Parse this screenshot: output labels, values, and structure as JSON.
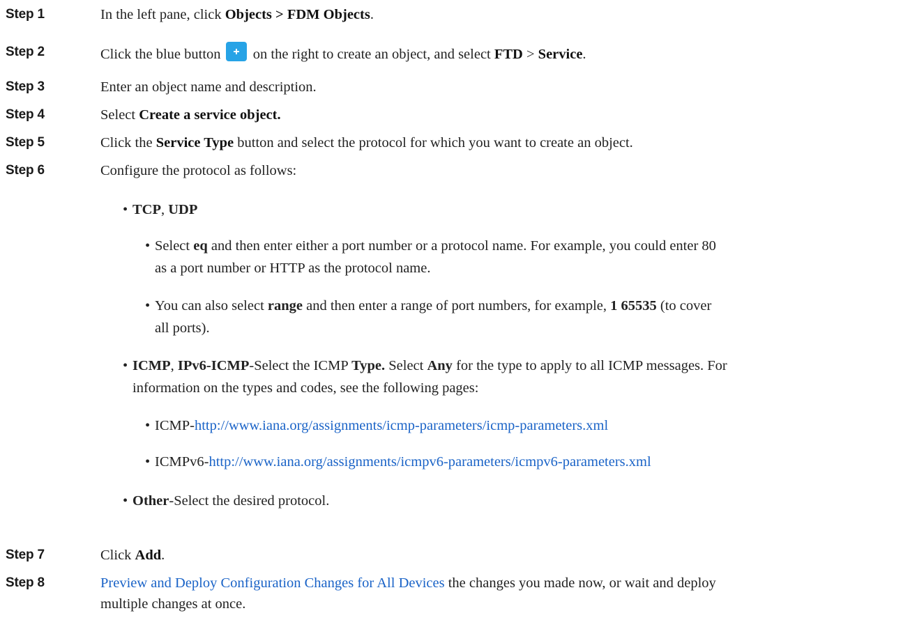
{
  "steps": [
    {
      "label": "Step 1",
      "pre": "In the left pane, click ",
      "bold": "Objects > FDM Objects",
      "post": "."
    },
    {
      "label": "Step 2",
      "pre": "Click the blue button",
      "mid": " on the right to create an object, and select ",
      "b1": "FTD",
      "sep": " > ",
      "b2": "Service",
      "post": "."
    },
    {
      "label": "Step 3",
      "text": "Enter an object name and description."
    },
    {
      "label": "Step 4",
      "pre": "Select ",
      "bold": "Create a service object."
    },
    {
      "label": "Step 5",
      "pre": "Click the ",
      "bold": "Service Type",
      "post": " button and select the protocol for which you want to create an object."
    },
    {
      "label": "Step 6",
      "text": "Configure the protocol as follows:"
    },
    {
      "label": "Step 7",
      "pre": "Click ",
      "bold": "Add",
      "post": "."
    },
    {
      "label": "Step 8",
      "link": "Preview and Deploy Configuration Changes for All Devices",
      "post1": " the changes you made now, or wait and deploy",
      "post2": "multiple changes at once."
    }
  ],
  "tcp": {
    "b1": "TCP",
    "sep": ", ",
    "b2": "UDP"
  },
  "eq": {
    "pre": "Select ",
    "bold": "eq",
    "line1": " and then enter either a port number or a protocol name. For example, you could enter 80",
    "line2": "as a port number or HTTP as the protocol name."
  },
  "range": {
    "pre": "You can also select ",
    "bold": "range",
    "mid": " and then enter a range of port numbers, for example, ",
    "bold2": "1 65535",
    "line1end": " (to cover",
    "line2": "all ports)."
  },
  "icmp": {
    "b1": "ICMP",
    "sep": ", ",
    "b2": "IPv6-ICMP",
    "mid": "-Select the ICMP ",
    "b3": "Type.",
    "mid2": " Select ",
    "b4": "Any",
    "line1end": " for the type to apply to all ICMP messages. For",
    "line2": "information on the types and codes, see the following pages:"
  },
  "icmp_links": [
    {
      "prefix": "ICMP-",
      "url": "http://www.iana.org/assignments/icmp-parameters/icmp-parameters.xml"
    },
    {
      "prefix": "ICMPv6-",
      "url": "http://www.iana.org/assignments/icmpv6-parameters/icmpv6-parameters.xml"
    }
  ],
  "other": {
    "bold": "Other",
    "post": "-Select the desired protocol."
  },
  "colors": {
    "link": "#1a63c7",
    "button": "#27a3e6"
  },
  "icons": {
    "add_button": "plus-icon"
  }
}
